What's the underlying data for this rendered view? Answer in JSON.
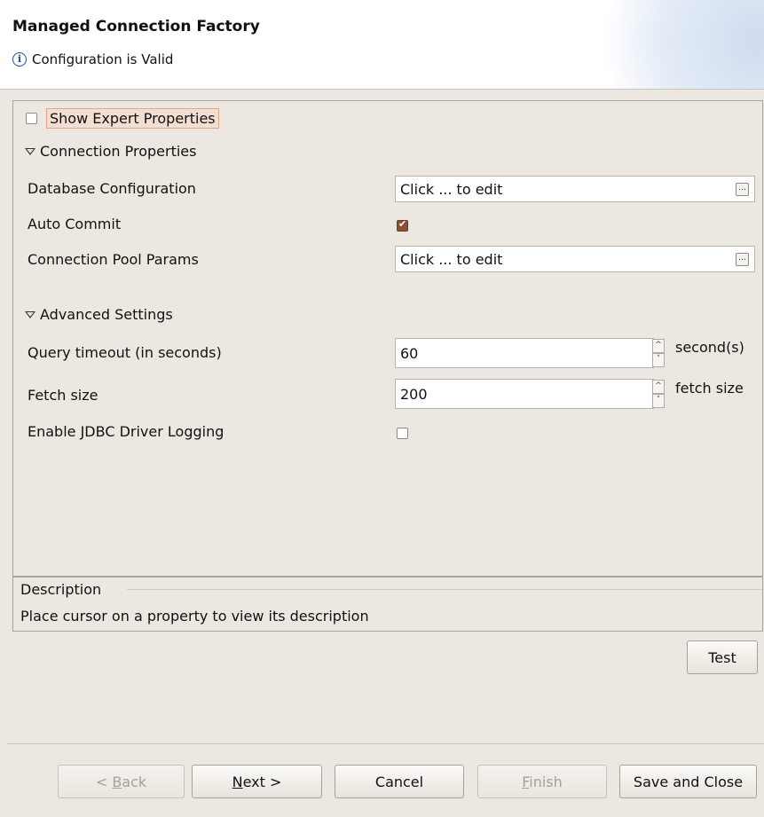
{
  "header": {
    "title": "Managed Connection Factory",
    "message": "Configuration is Valid",
    "message_icon": "info-icon"
  },
  "panel": {
    "show_expert_label": "Show Expert Properties",
    "show_expert_checked": false,
    "connection_section": "Connection Properties",
    "properties": {
      "db_config_label": "Database Configuration",
      "db_config_value": "Click ... to edit",
      "auto_commit_label": "Auto Commit",
      "auto_commit_checked": true,
      "pool_params_label": "Connection Pool Params",
      "pool_params_value": "Click ... to edit"
    },
    "advanced_section": "Advanced Settings",
    "advanced": {
      "query_timeout_label": "Query timeout (in seconds)",
      "query_timeout_value": "60",
      "query_timeout_unit": "second(s)",
      "fetch_size_label": "Fetch size",
      "fetch_size_value": "200",
      "fetch_size_unit": "fetch size",
      "jdbc_logging_label": "Enable JDBC Driver Logging",
      "jdbc_logging_checked": false
    }
  },
  "description": {
    "title": "Description",
    "text": "Place cursor on a property to view its description"
  },
  "buttons": {
    "test": "Test",
    "back_prefix": "< ",
    "back_mnemonic": "B",
    "back_rest": "ack",
    "next_mnemonic": "N",
    "next_rest": "ext >",
    "cancel": "Cancel",
    "finish_mnemonic": "F",
    "finish_rest": "inish",
    "save_close": "Save and Close"
  },
  "colors": {
    "background": "#ece8e1",
    "checked_accent": "#8e4f37",
    "highlight_border": "#e5a58b"
  }
}
